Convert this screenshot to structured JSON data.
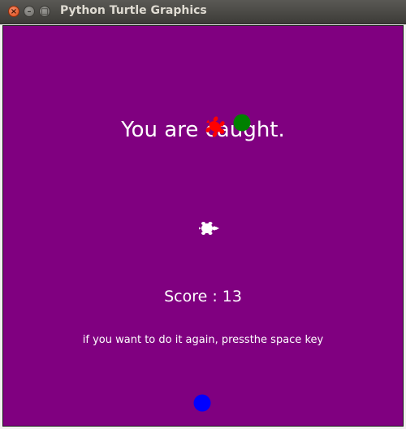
{
  "window": {
    "title": "Python Turtle Graphics"
  },
  "game": {
    "message": "You are caught.",
    "score_text": "Score : 13",
    "score": 13,
    "hint": "if you want to do it again, pressthe space key"
  },
  "colors": {
    "background": "#800080",
    "enemy_turtle": "#ff0000",
    "green_dot": "#008000",
    "blue_dot": "#0000ff",
    "player_turtle": "#ffffff"
  },
  "icons": {
    "close": "close-icon",
    "minimize": "minimize-icon",
    "maximize": "maximize-icon"
  }
}
